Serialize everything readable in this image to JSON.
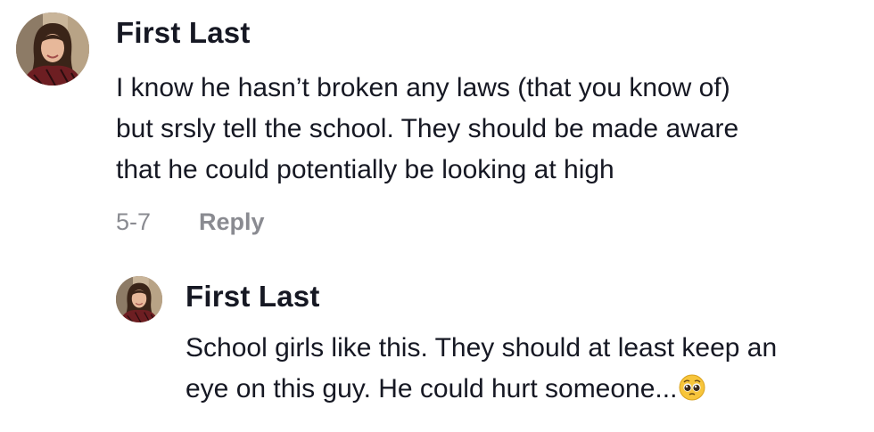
{
  "comment": {
    "author": "First Last",
    "text_lines": [
      "I know he hasn’t broken any laws (that you know of)",
      "but srsly tell the school. They should be made aware",
      "that he could potentially be looking at high"
    ],
    "date": "5-7",
    "reply_label": "Reply"
  },
  "reply": {
    "author": "First Last",
    "text_lines": [
      "School girls like this. They should at least keep an",
      "eye on this guy. He could hurt someone..."
    ],
    "emoji": "pleading-face-icon"
  }
}
